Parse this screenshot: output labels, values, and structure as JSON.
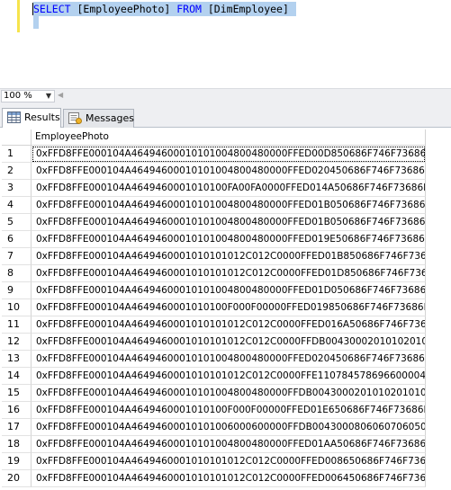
{
  "editor": {
    "query_tokens": [
      {
        "text": "SELECT",
        "kind": "keyword"
      },
      {
        "text": " [EmployeePhoto] ",
        "kind": "identifier"
      },
      {
        "text": "FROM",
        "kind": "keyword"
      },
      {
        "text": " [DimEmployee]",
        "kind": "identifier"
      }
    ]
  },
  "zoom": {
    "value": "100 %"
  },
  "tabs": [
    {
      "label": "Results",
      "icon": "grid-icon",
      "active": true
    },
    {
      "label": "Messages",
      "icon": "messages-icon",
      "active": false
    }
  ],
  "grid": {
    "column_header": "EmployeePhoto",
    "rows": [
      {
        "num": "1",
        "value": "0xFFD8FFE000104A46494600010101004800480000FFED00D850686F746F73686F70..."
      },
      {
        "num": "2",
        "value": "0xFFD8FFE000104A46494600010101004800480000FFED020450686F746F73686F70..."
      },
      {
        "num": "3",
        "value": "0xFFD8FFE000104A4649460001010100FA00FA0000FFED014A50686F746F73686F7..."
      },
      {
        "num": "4",
        "value": "0xFFD8FFE000104A46494600010101004800480000FFED01B050686F746F73686F70..."
      },
      {
        "num": "5",
        "value": "0xFFD8FFE000104A46494600010101004800480000FFED01B050686F746F73686F70..."
      },
      {
        "num": "6",
        "value": "0xFFD8FFE000104A46494600010101004800480000FFED019E50686F746F73686F70..."
      },
      {
        "num": "7",
        "value": "0xFFD8FFE000104A4649460001010101012C012C0000FFED01B850686F746F73686F7..."
      },
      {
        "num": "8",
        "value": "0xFFD8FFE000104A4649460001010101012C012C0000FFED01D850686F746F73686F7..."
      },
      {
        "num": "9",
        "value": "0xFFD8FFE000104A46494600010101004800480000FFED01D050686F746F73686F70..."
      },
      {
        "num": "10",
        "value": "0xFFD8FFE000104A4649460001010100F000F00000FFED019850686F746F73686F70..."
      },
      {
        "num": "11",
        "value": "0xFFD8FFE000104A4649460001010101012C012C0000FFED016A50686F746F73686F7..."
      },
      {
        "num": "12",
        "value": "0xFFD8FFE000104A4649460001010101012C012C0000FFDB004300020101020101202..."
      },
      {
        "num": "13",
        "value": "0xFFD8FFE000104A46494600010101004800480000FFED020450686F746F73686F70..."
      },
      {
        "num": "14",
        "value": "0xFFD8FFE000104A4649460001010101012C012C0000FFE110784578696600004D4D0..."
      },
      {
        "num": "15",
        "value": "0xFFD8FFE000104A46494600010101004800480000FFDB00430002010102010101202..."
      },
      {
        "num": "16",
        "value": "0xFFD8FFE000104A4649460001010100F000F00000FFED01E650686F746F73686F70..."
      },
      {
        "num": "17",
        "value": "0xFFD8FFE000104A46494600010101006000600000FFDB0043000806060706050807..."
      },
      {
        "num": "18",
        "value": "0xFFD8FFE000104A46494600010101004800480000FFED01AA50686F746F73686F70..."
      },
      {
        "num": "19",
        "value": "0xFFD8FFE000104A4649460001010101012C012C0000FFED008650686F746F73686F70..."
      },
      {
        "num": "20",
        "value": "0xFFD8FFE000104A4649460001010101012C012C0000FFED006450686F746F73686F70..."
      }
    ]
  }
}
